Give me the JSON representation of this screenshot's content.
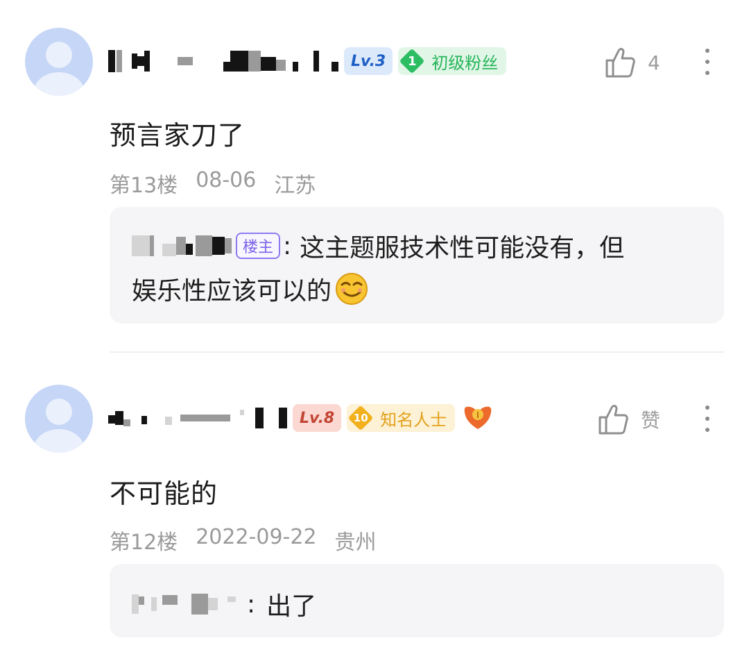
{
  "comments": [
    {
      "level_badge": "Lv.3",
      "fan_badge": {
        "level": "1",
        "label": "初级粉丝"
      },
      "likes": "4",
      "content": "预言家刀了",
      "floor": "第13楼",
      "date": "08-06",
      "location": "江苏",
      "reply": {
        "owner_badge": "楼主",
        "colon": ":",
        "line1": "这主题服技术性可能没有，但",
        "line2": "娱乐性应该可以的",
        "emoji": "smirk-emoji"
      }
    },
    {
      "level_badge": "Lv.8",
      "fan_badge": {
        "level": "10",
        "label": "知名人士"
      },
      "likes": "赞",
      "content": "不可能的",
      "floor": "第12楼",
      "date": "2022-09-22",
      "location": "贵州",
      "honor_icon": "heart-medal-icon",
      "reply": {
        "colon": ":",
        "line1": "出了"
      }
    }
  ],
  "icons": {
    "avatar": "default-avatar-icon",
    "like": "thumbs-up-icon",
    "more": "more-vertical-icon"
  },
  "colors": {
    "avatar_bg": "#c6d6f7",
    "lv3": "#1f5fc6",
    "lv8": "#c24535",
    "fan_green": "#26b559",
    "fan_gold": "#e2a21a",
    "owner_badge": "#7b62ea"
  }
}
